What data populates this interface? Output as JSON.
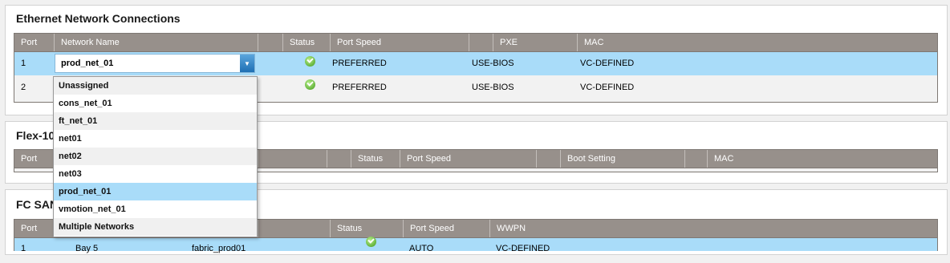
{
  "ethernet": {
    "title": "Ethernet Network Connections",
    "headers": [
      "Port",
      "Network Name",
      "",
      "Status",
      "Port Speed",
      "",
      "PXE",
      "MAC"
    ],
    "rows": [
      {
        "port": "1",
        "network": "prod_net_01",
        "speed": "PREFERRED",
        "pxe": "USE-BIOS",
        "mac": "VC-DEFINED",
        "status_icon": "ok-icon"
      },
      {
        "port": "2",
        "network": "",
        "speed": "PREFERRED",
        "pxe": "USE-BIOS",
        "mac": "VC-DEFINED",
        "status_icon": "ok-icon"
      }
    ],
    "dropdown": {
      "selected": "prod_net_01",
      "options": [
        "Unassigned",
        "cons_net_01",
        "ft_net_01",
        "net01",
        "net02",
        "net03",
        "prod_net_01",
        "vmotion_net_01",
        "Multiple Networks"
      ]
    }
  },
  "flex": {
    "title": "Flex-10",
    "headers": [
      "Port",
      "",
      "",
      "Status",
      "Port Speed",
      "",
      "Boot Setting",
      "",
      "MAC"
    ]
  },
  "fcsan": {
    "title": "FC SAN",
    "headers": [
      "Port",
      "",
      "",
      "Status",
      "Port Speed",
      "WWPN"
    ],
    "rows": [
      {
        "port": "1",
        "bay": "Bay 5",
        "fabric": "fabric_prod01",
        "speed": "AUTO",
        "wwpn": "VC-DEFINED"
      }
    ]
  },
  "colors": {
    "header_bg": "#97908b",
    "selected_row": "#a9dcf9",
    "accent": "#1f6fb3"
  }
}
